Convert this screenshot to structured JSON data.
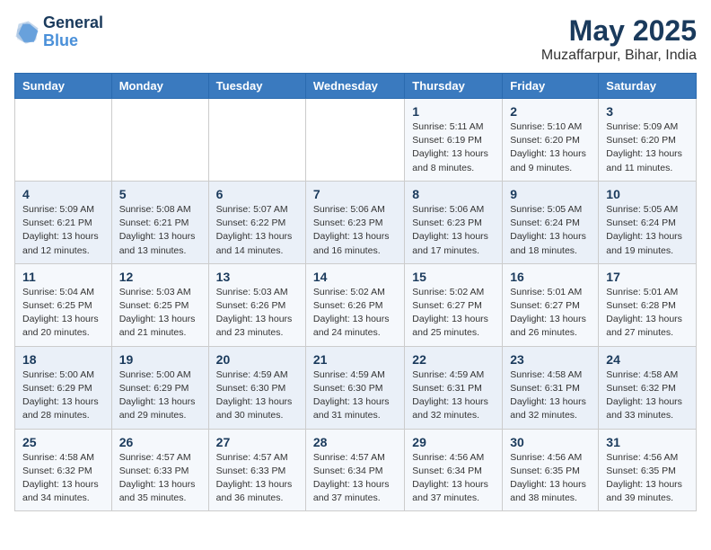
{
  "logo": {
    "line1": "General",
    "line2": "Blue"
  },
  "title": "May 2025",
  "location": "Muzaffarpur, Bihar, India",
  "days_of_week": [
    "Sunday",
    "Monday",
    "Tuesday",
    "Wednesday",
    "Thursday",
    "Friday",
    "Saturday"
  ],
  "weeks": [
    [
      {
        "day": "",
        "info": ""
      },
      {
        "day": "",
        "info": ""
      },
      {
        "day": "",
        "info": ""
      },
      {
        "day": "",
        "info": ""
      },
      {
        "day": "1",
        "info": "Sunrise: 5:11 AM\nSunset: 6:19 PM\nDaylight: 13 hours\nand 8 minutes."
      },
      {
        "day": "2",
        "info": "Sunrise: 5:10 AM\nSunset: 6:20 PM\nDaylight: 13 hours\nand 9 minutes."
      },
      {
        "day": "3",
        "info": "Sunrise: 5:09 AM\nSunset: 6:20 PM\nDaylight: 13 hours\nand 11 minutes."
      }
    ],
    [
      {
        "day": "4",
        "info": "Sunrise: 5:09 AM\nSunset: 6:21 PM\nDaylight: 13 hours\nand 12 minutes."
      },
      {
        "day": "5",
        "info": "Sunrise: 5:08 AM\nSunset: 6:21 PM\nDaylight: 13 hours\nand 13 minutes."
      },
      {
        "day": "6",
        "info": "Sunrise: 5:07 AM\nSunset: 6:22 PM\nDaylight: 13 hours\nand 14 minutes."
      },
      {
        "day": "7",
        "info": "Sunrise: 5:06 AM\nSunset: 6:23 PM\nDaylight: 13 hours\nand 16 minutes."
      },
      {
        "day": "8",
        "info": "Sunrise: 5:06 AM\nSunset: 6:23 PM\nDaylight: 13 hours\nand 17 minutes."
      },
      {
        "day": "9",
        "info": "Sunrise: 5:05 AM\nSunset: 6:24 PM\nDaylight: 13 hours\nand 18 minutes."
      },
      {
        "day": "10",
        "info": "Sunrise: 5:05 AM\nSunset: 6:24 PM\nDaylight: 13 hours\nand 19 minutes."
      }
    ],
    [
      {
        "day": "11",
        "info": "Sunrise: 5:04 AM\nSunset: 6:25 PM\nDaylight: 13 hours\nand 20 minutes."
      },
      {
        "day": "12",
        "info": "Sunrise: 5:03 AM\nSunset: 6:25 PM\nDaylight: 13 hours\nand 21 minutes."
      },
      {
        "day": "13",
        "info": "Sunrise: 5:03 AM\nSunset: 6:26 PM\nDaylight: 13 hours\nand 23 minutes."
      },
      {
        "day": "14",
        "info": "Sunrise: 5:02 AM\nSunset: 6:26 PM\nDaylight: 13 hours\nand 24 minutes."
      },
      {
        "day": "15",
        "info": "Sunrise: 5:02 AM\nSunset: 6:27 PM\nDaylight: 13 hours\nand 25 minutes."
      },
      {
        "day": "16",
        "info": "Sunrise: 5:01 AM\nSunset: 6:27 PM\nDaylight: 13 hours\nand 26 minutes."
      },
      {
        "day": "17",
        "info": "Sunrise: 5:01 AM\nSunset: 6:28 PM\nDaylight: 13 hours\nand 27 minutes."
      }
    ],
    [
      {
        "day": "18",
        "info": "Sunrise: 5:00 AM\nSunset: 6:29 PM\nDaylight: 13 hours\nand 28 minutes."
      },
      {
        "day": "19",
        "info": "Sunrise: 5:00 AM\nSunset: 6:29 PM\nDaylight: 13 hours\nand 29 minutes."
      },
      {
        "day": "20",
        "info": "Sunrise: 4:59 AM\nSunset: 6:30 PM\nDaylight: 13 hours\nand 30 minutes."
      },
      {
        "day": "21",
        "info": "Sunrise: 4:59 AM\nSunset: 6:30 PM\nDaylight: 13 hours\nand 31 minutes."
      },
      {
        "day": "22",
        "info": "Sunrise: 4:59 AM\nSunset: 6:31 PM\nDaylight: 13 hours\nand 32 minutes."
      },
      {
        "day": "23",
        "info": "Sunrise: 4:58 AM\nSunset: 6:31 PM\nDaylight: 13 hours\nand 32 minutes."
      },
      {
        "day": "24",
        "info": "Sunrise: 4:58 AM\nSunset: 6:32 PM\nDaylight: 13 hours\nand 33 minutes."
      }
    ],
    [
      {
        "day": "25",
        "info": "Sunrise: 4:58 AM\nSunset: 6:32 PM\nDaylight: 13 hours\nand 34 minutes."
      },
      {
        "day": "26",
        "info": "Sunrise: 4:57 AM\nSunset: 6:33 PM\nDaylight: 13 hours\nand 35 minutes."
      },
      {
        "day": "27",
        "info": "Sunrise: 4:57 AM\nSunset: 6:33 PM\nDaylight: 13 hours\nand 36 minutes."
      },
      {
        "day": "28",
        "info": "Sunrise: 4:57 AM\nSunset: 6:34 PM\nDaylight: 13 hours\nand 37 minutes."
      },
      {
        "day": "29",
        "info": "Sunrise: 4:56 AM\nSunset: 6:34 PM\nDaylight: 13 hours\nand 37 minutes."
      },
      {
        "day": "30",
        "info": "Sunrise: 4:56 AM\nSunset: 6:35 PM\nDaylight: 13 hours\nand 38 minutes."
      },
      {
        "day": "31",
        "info": "Sunrise: 4:56 AM\nSunset: 6:35 PM\nDaylight: 13 hours\nand 39 minutes."
      }
    ]
  ]
}
